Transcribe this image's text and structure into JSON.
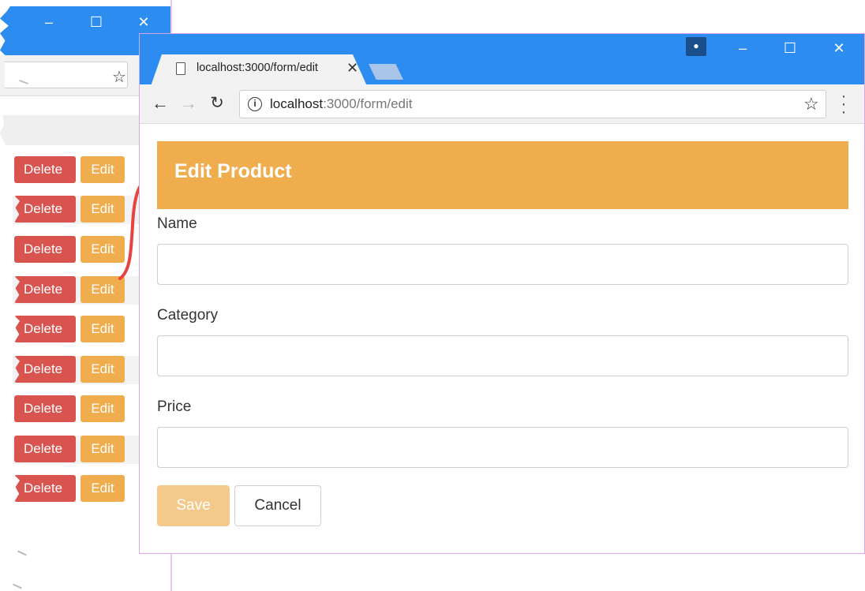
{
  "background_window": {
    "rows": [
      {
        "delete_label": "Delete",
        "edit_label": "Edit"
      },
      {
        "delete_label": "Delete",
        "edit_label": "Edit"
      },
      {
        "delete_label": "Delete",
        "edit_label": "Edit"
      },
      {
        "delete_label": "Delete",
        "edit_label": "Edit"
      },
      {
        "delete_label": "Delete",
        "edit_label": "Edit"
      },
      {
        "delete_label": "Delete",
        "edit_label": "Edit"
      },
      {
        "delete_label": "Delete",
        "edit_label": "Edit"
      },
      {
        "delete_label": "Delete",
        "edit_label": "Edit"
      },
      {
        "delete_label": "Delete",
        "edit_label": "Edit"
      }
    ]
  },
  "browser": {
    "tab_title": "localhost:3000/form/edit",
    "address": {
      "host": "localhost",
      "rest": ":3000/form/edit"
    },
    "colors": {
      "titlebar": "#2d8cf0",
      "toolbar": "#f2f2f2"
    }
  },
  "form": {
    "heading": "Edit Product",
    "fields": [
      {
        "label": "Name",
        "value": ""
      },
      {
        "label": "Category",
        "value": ""
      },
      {
        "label": "Price",
        "value": ""
      }
    ],
    "save_label": "Save",
    "cancel_label": "Cancel",
    "colors": {
      "heading_bg": "#f0ad4e",
      "delete": "#d9534f",
      "edit": "#f0ad4e",
      "arrow": "#e8433f"
    }
  },
  "icons": [
    "page-icon",
    "close-icon",
    "back-arrow-icon",
    "forward-arrow-icon",
    "reload-icon",
    "info-icon",
    "star-icon",
    "menu-icon",
    "user-icon",
    "minimize-icon",
    "maximize-icon",
    "window-close-icon"
  ]
}
